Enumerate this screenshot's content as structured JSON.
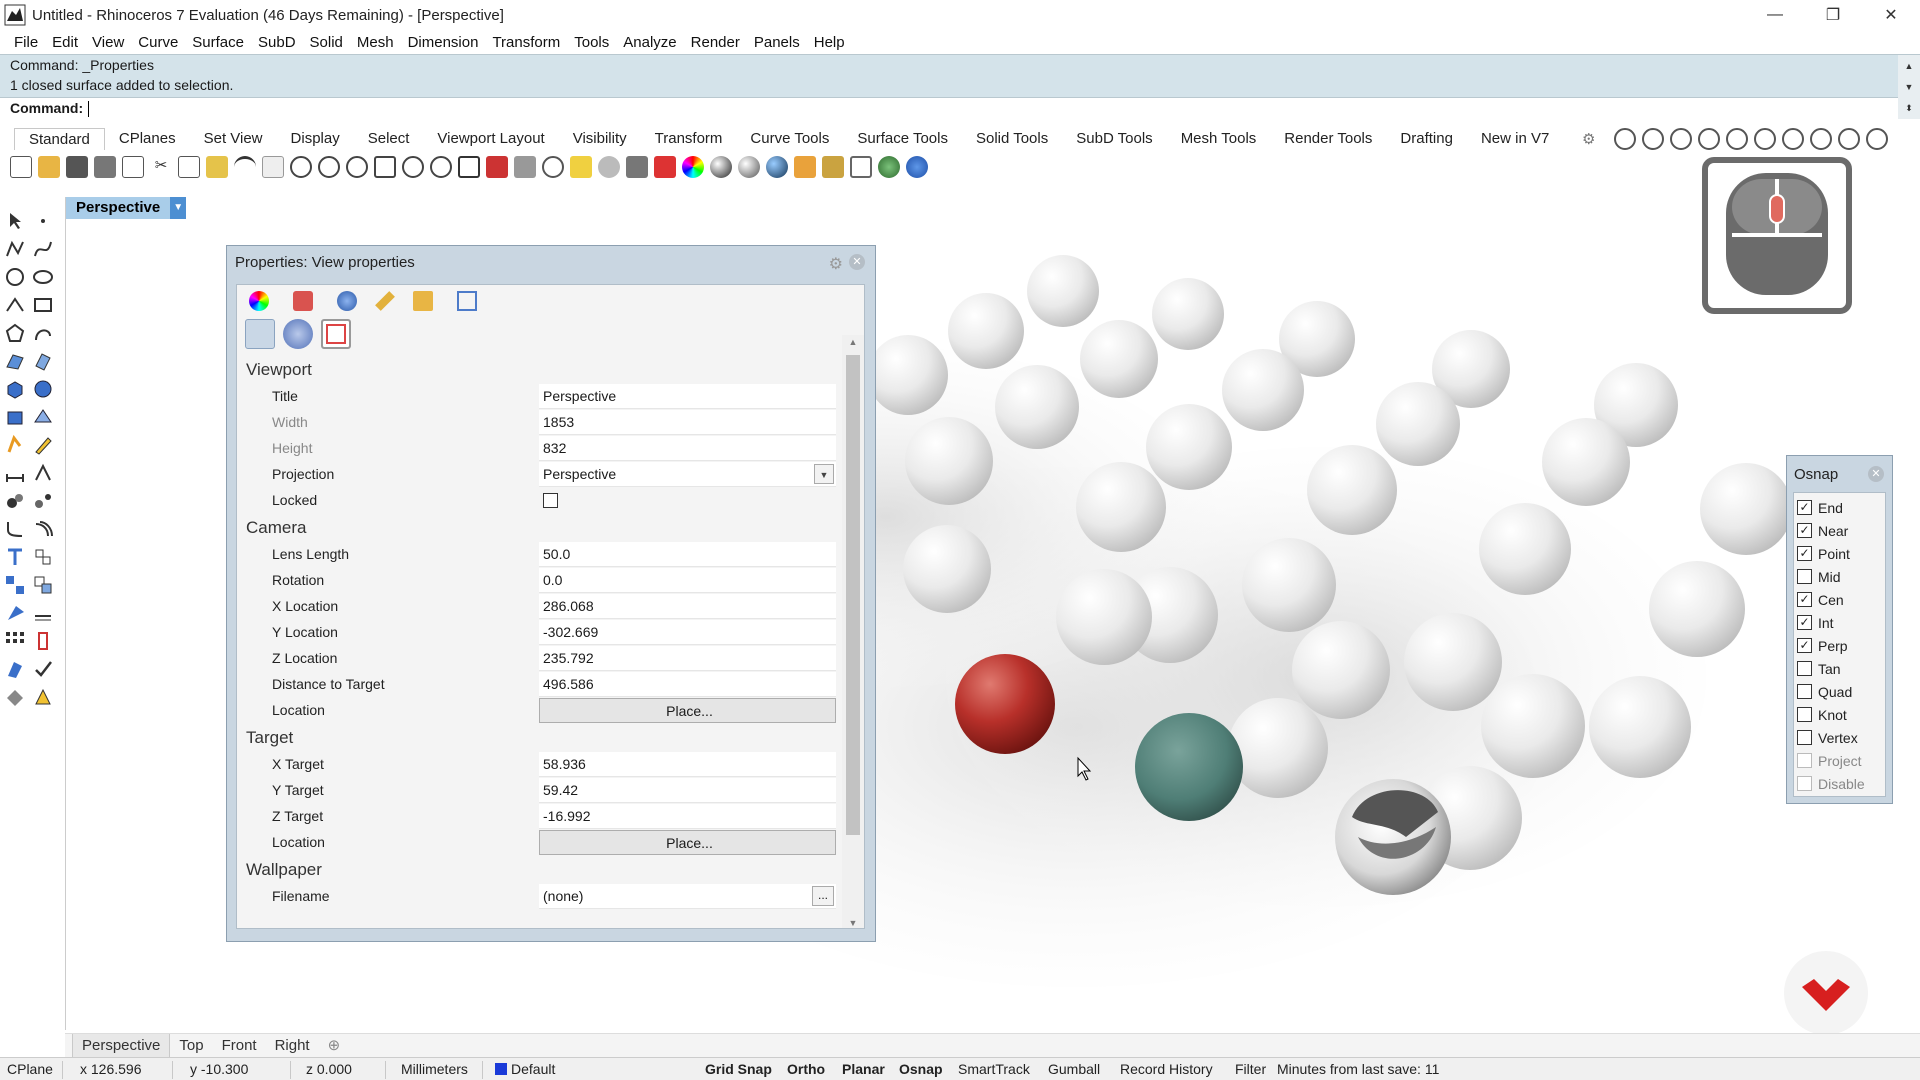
{
  "window": {
    "title": "Untitled - Rhinoceros 7 Evaluation (46 Days Remaining) - [Perspective]",
    "controls": {
      "minimize": "—",
      "restore": "❐",
      "close": "✕"
    }
  },
  "menu": [
    "File",
    "Edit",
    "View",
    "Curve",
    "Surface",
    "SubD",
    "Solid",
    "Mesh",
    "Dimension",
    "Transform",
    "Tools",
    "Analyze",
    "Render",
    "Panels",
    "Help"
  ],
  "command": {
    "history": [
      "Command: _Properties",
      "1 closed surface added to selection."
    ],
    "prompt": "Command:"
  },
  "toolbar_tabs": [
    "Standard",
    "CPlanes",
    "Set View",
    "Display",
    "Select",
    "Viewport Layout",
    "Visibility",
    "Transform",
    "Curve Tools",
    "Surface Tools",
    "Solid Tools",
    "SubD Tools",
    "Mesh Tools",
    "Render Tools",
    "Drafting",
    "New in V7"
  ],
  "viewport": {
    "name": "Perspective"
  },
  "properties": {
    "title": "Properties: View properties",
    "sections": {
      "viewport": "Viewport",
      "camera": "Camera",
      "target": "Target",
      "wallpaper": "Wallpaper"
    },
    "viewport_rows": [
      {
        "key": "Title",
        "value": "Perspective"
      },
      {
        "key": "Width",
        "value": "1853"
      },
      {
        "key": "Height",
        "value": "832"
      },
      {
        "key": "Projection",
        "value": "Perspective"
      },
      {
        "key": "Locked",
        "value": "",
        "checked": false
      }
    ],
    "camera_rows": [
      {
        "key": "Lens Length",
        "value": "50.0"
      },
      {
        "key": "Rotation",
        "value": "0.0"
      },
      {
        "key": "X Location",
        "value": "286.068"
      },
      {
        "key": "Y Location",
        "value": "-302.669"
      },
      {
        "key": "Z Location",
        "value": "235.792"
      },
      {
        "key": "Distance to Target",
        "value": "496.586"
      },
      {
        "key": "Location",
        "value": "Place..."
      }
    ],
    "target_rows": [
      {
        "key": "X Target",
        "value": "58.936"
      },
      {
        "key": "Y Target",
        "value": "59.42"
      },
      {
        "key": "Z Target",
        "value": "-16.992"
      },
      {
        "key": "Location",
        "value": "Place..."
      }
    ],
    "wallpaper_rows": [
      {
        "key": "Filename",
        "value": "(none)"
      }
    ]
  },
  "osnap": {
    "title": "Osnap",
    "items": [
      {
        "label": "End",
        "checked": true
      },
      {
        "label": "Near",
        "checked": true
      },
      {
        "label": "Point",
        "checked": true
      },
      {
        "label": "Mid",
        "checked": false
      },
      {
        "label": "Cen",
        "checked": true
      },
      {
        "label": "Int",
        "checked": true
      },
      {
        "label": "Perp",
        "checked": true
      },
      {
        "label": "Tan",
        "checked": false
      },
      {
        "label": "Quad",
        "checked": false
      },
      {
        "label": "Knot",
        "checked": false
      },
      {
        "label": "Vertex",
        "checked": false
      },
      {
        "label": "Project",
        "checked": false
      },
      {
        "label": "Disable",
        "checked": false
      }
    ]
  },
  "view_tabs": [
    "Perspective",
    "Top",
    "Front",
    "Right"
  ],
  "status": {
    "cplane": "CPlane",
    "x": "x 126.596",
    "y": "y -10.300",
    "z": "z 0.000",
    "units": "Millimeters",
    "layer": "Default",
    "grid_snap": "Grid Snap",
    "ortho": "Ortho",
    "planar": "Planar",
    "osnap": "Osnap",
    "smarttrack": "SmartTrack",
    "gumball": "Gumball",
    "record_history": "Record History",
    "filter": "Filter",
    "save_info": "Minutes from last save: 11"
  },
  "colors": {
    "command_bg": "#d4e3ea",
    "panel_bg": "#c9d6e1",
    "viewport_tag": "#a9cde9",
    "red_sphere": "#b8302a",
    "teal_sphere": "#4f7e76",
    "layer_swatch": "#1a3ad8"
  }
}
